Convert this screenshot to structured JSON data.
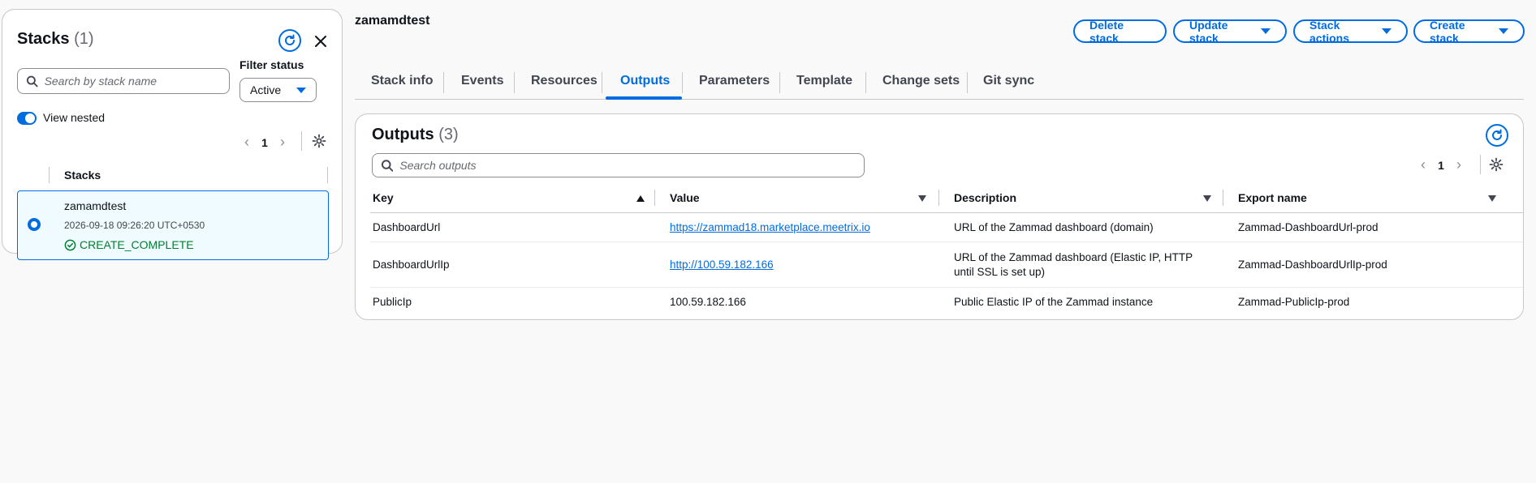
{
  "sidebar": {
    "title": "Stacks",
    "count": "(1)",
    "filter_status_label": "Filter status",
    "search_placeholder": "Search by stack name",
    "filter_value": "Active",
    "view_nested_label": "View nested",
    "page": "1",
    "column_header": "Stacks",
    "stack": {
      "name": "zamamdtest",
      "timestamp": "2026-09-18 09:26:20 UTC+0530",
      "status": "CREATE_COMPLETE"
    }
  },
  "header": {
    "title": "zamamdtest",
    "buttons": {
      "delete": "Delete stack",
      "update": "Update stack",
      "actions": "Stack actions",
      "create": "Create stack"
    }
  },
  "tabs": [
    {
      "label": "Stack info"
    },
    {
      "label": "Events"
    },
    {
      "label": "Resources"
    },
    {
      "label": "Outputs"
    },
    {
      "label": "Parameters"
    },
    {
      "label": "Template"
    },
    {
      "label": "Change sets"
    },
    {
      "label": "Git sync"
    }
  ],
  "outputs": {
    "title": "Outputs",
    "count": "(3)",
    "search_placeholder": "Search outputs",
    "page": "1",
    "columns": [
      "Key",
      "Value",
      "Description",
      "Export name"
    ],
    "rows": [
      {
        "key": "DashboardUrl",
        "value": "https://zammad18.marketplace.meetrix.io",
        "description": "URL of the Zammad dashboard (domain)",
        "export": "Zammad-DashboardUrl-prod"
      },
      {
        "key": "DashboardUrlIp",
        "value": "http://100.59.182.166",
        "description": "URL of the Zammad dashboard (Elastic IP, HTTP until SSL is set up)",
        "export": "Zammad-DashboardUrlIp-prod"
      },
      {
        "key": "PublicIp",
        "value": "100.59.182.166",
        "description": "Public Elastic IP of the Zammad instance",
        "export": "Zammad-PublicIp-prod"
      }
    ]
  },
  "colors": {
    "accent": "#006ce0",
    "success": "#00802f",
    "border": "#c6c6cd"
  }
}
